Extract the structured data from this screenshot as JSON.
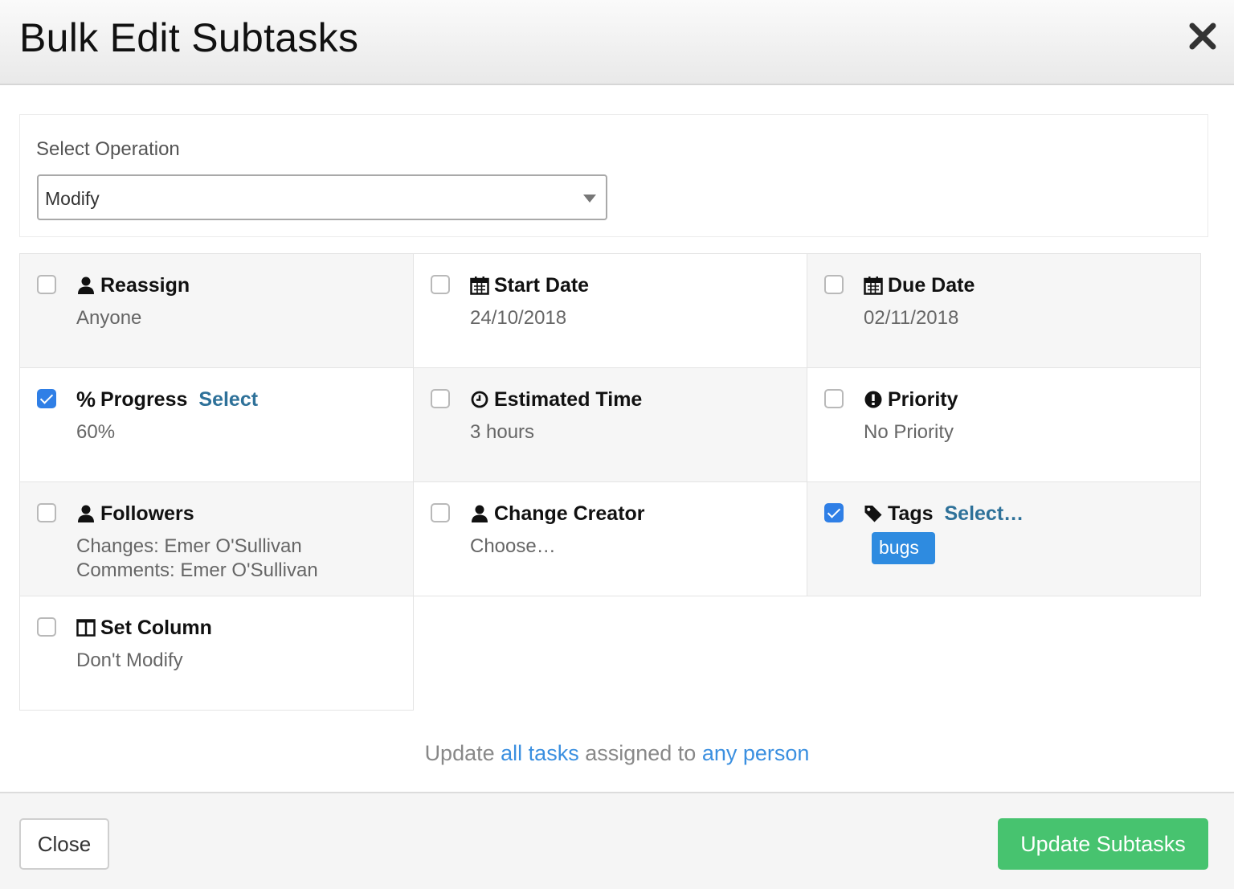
{
  "dialog": {
    "title": "Bulk Edit Subtasks",
    "close_icon": "close-icon"
  },
  "operation": {
    "label": "Select Operation",
    "selected": "Modify"
  },
  "fields": {
    "reassign": {
      "label": "Reassign",
      "value": "Anyone",
      "checked": false,
      "icon": "user-icon"
    },
    "start_date": {
      "label": "Start Date",
      "value": "24/10/2018",
      "checked": false,
      "icon": "calendar-icon"
    },
    "due_date": {
      "label": "Due Date",
      "value": "02/11/2018",
      "checked": false,
      "icon": "calendar-icon"
    },
    "progress": {
      "prefix": "%",
      "label": "Progress",
      "link": "Select",
      "value": "60%",
      "checked": true
    },
    "estimated_time": {
      "label": "Estimated Time",
      "value": "3 hours",
      "checked": false,
      "icon": "clock-icon"
    },
    "priority": {
      "label": "Priority",
      "value": "No Priority",
      "checked": false,
      "icon": "exclamation-circle-icon"
    },
    "followers": {
      "label": "Followers",
      "value_line1": "Changes: Emer O'Sullivan",
      "value_line2": "Comments: Emer O'Sullivan",
      "checked": false,
      "icon": "user-icon"
    },
    "change_creator": {
      "label": "Change Creator",
      "value": "Choose…",
      "checked": false,
      "icon": "user-icon"
    },
    "tags": {
      "label": "Tags",
      "link": "Select…",
      "checked": true,
      "icon": "tag-icon",
      "tag_items": [
        "bugs"
      ]
    },
    "set_column": {
      "label": "Set Column",
      "value": "Don't Modify",
      "checked": false,
      "icon": "columns-icon"
    }
  },
  "summary": {
    "part1": "Update",
    "link1": "all tasks",
    "part2": "assigned to",
    "link2": "any person"
  },
  "footer": {
    "close_label": "Close",
    "update_label": "Update Subtasks"
  },
  "colors": {
    "accent_blue": "#2f7fe6",
    "link_teal": "#2e7199",
    "success_green": "#47c36f",
    "tag_blue": "#2e8be0"
  }
}
